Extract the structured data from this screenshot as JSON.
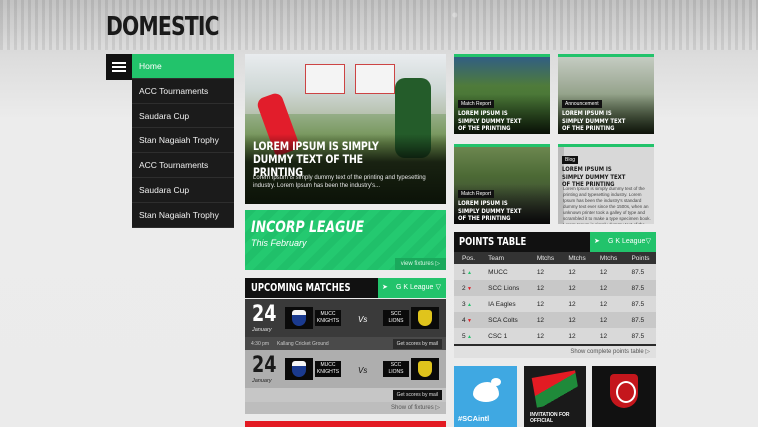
{
  "page": {
    "title": "DOMESTIC"
  },
  "menu": {
    "toggle_icon": "hamburger-icon"
  },
  "sidebar": {
    "items": [
      {
        "label": "Home",
        "active": true
      },
      {
        "label": "ACC Tournaments",
        "active": false
      },
      {
        "label": "Saudara Cup",
        "active": false
      },
      {
        "label": "Stan Nagaiah Trophy",
        "active": false
      },
      {
        "label": "ACC Tournaments",
        "active": false
      },
      {
        "label": "Saudara Cup",
        "active": false
      },
      {
        "label": "Stan Nagaiah Trophy",
        "active": false
      }
    ]
  },
  "hero": {
    "headline": "LOREM IPSUM IS SIMPLY DUMMY TEXT OF THE PRINTING",
    "summary": "Lorem Ipsum is simply dummy text of the printing and typesetting industry. Lorem Ipsum has been the industry's..."
  },
  "news_cards": [
    {
      "tag": "Match Report",
      "title": "LOREM IPSUM IS SIMPLY DUMMY TEXT OF THE PRINTING"
    },
    {
      "tag": "Announcement",
      "title": "LOREM IPSUM IS SIMPLY DUMMY TEXT OF THE PRINTING"
    },
    {
      "tag": "Match Report",
      "title": "LOREM IPSUM IS SIMPLY DUMMY TEXT OF THE PRINTING"
    },
    {
      "tag": "Blog",
      "title": "LOREM IPSUM IS SIMPLY DUMMY TEXT OF THE PRINTING",
      "description": "Lorem Ipsum is simply dummy text of the printing and typesetting industry. Lorem Ipsum has been the industry's standard dummy text ever since the 1500s, when an unknown printer took a galley of type and scrambled it to make a type specimen book. Lorem Ipsum is simply dummy text of the printing and typesetting industry. Lorem Ipsum has been the industry's standard..."
    }
  ],
  "league": {
    "name": "INCORP LEAGUE",
    "date": "This February",
    "link": "view fixtures ▷"
  },
  "upcoming": {
    "title": "UPCOMING MATCHES",
    "selector": "G K League",
    "matches": [
      {
        "day": "24",
        "month": "January",
        "team_a": "MUCC KNIGHTS",
        "vs": "Vs",
        "team_b": "SCC LIONS",
        "time": "4:30 pm",
        "venue": "Kallang Cricket Ground",
        "button": "Get scores by mail"
      },
      {
        "day": "24",
        "month": "January",
        "team_a": "MUCC KNIGHTS",
        "vs": "Vs",
        "team_b": "SCC LIONS",
        "time": "",
        "venue": "",
        "button": "Get scores by mail"
      }
    ],
    "link": "Show of fixtures ▷"
  },
  "points_table": {
    "title": "POINTS TABLE",
    "selector": "G K League",
    "columns": [
      "Pos.",
      "Team",
      "Mtchs",
      "Mtchs",
      "Mtchs",
      "Points"
    ],
    "rows": [
      {
        "pos": "1",
        "trend": "up",
        "team": "MUCC",
        "m1": "12",
        "m2": "12",
        "m3": "12",
        "points": "87.5"
      },
      {
        "pos": "2",
        "trend": "down",
        "team": "SCC Lions",
        "m1": "12",
        "m2": "12",
        "m3": "12",
        "points": "87.5"
      },
      {
        "pos": "3",
        "trend": "up",
        "team": "IA Eagles",
        "m1": "12",
        "m2": "12",
        "m3": "12",
        "points": "87.5"
      },
      {
        "pos": "4",
        "trend": "down",
        "team": "SCA Colts",
        "m1": "12",
        "m2": "12",
        "m3": "12",
        "points": "87.5"
      },
      {
        "pos": "5",
        "trend": "up",
        "team": "CSC 1",
        "m1": "12",
        "m2": "12",
        "m3": "12",
        "points": "87.5"
      }
    ],
    "link": "Show complete points table ▷"
  },
  "social": {
    "twitter_tag": "#SCAintl",
    "invitation": "INVITATION FOR OFFICIAL",
    "icons": [
      "twitter-icon",
      "sg-shield-icon"
    ]
  },
  "colors": {
    "accent": "#22c36b",
    "dark": "#111111",
    "red": "#e31b23",
    "twitter": "#3fa8e2"
  }
}
